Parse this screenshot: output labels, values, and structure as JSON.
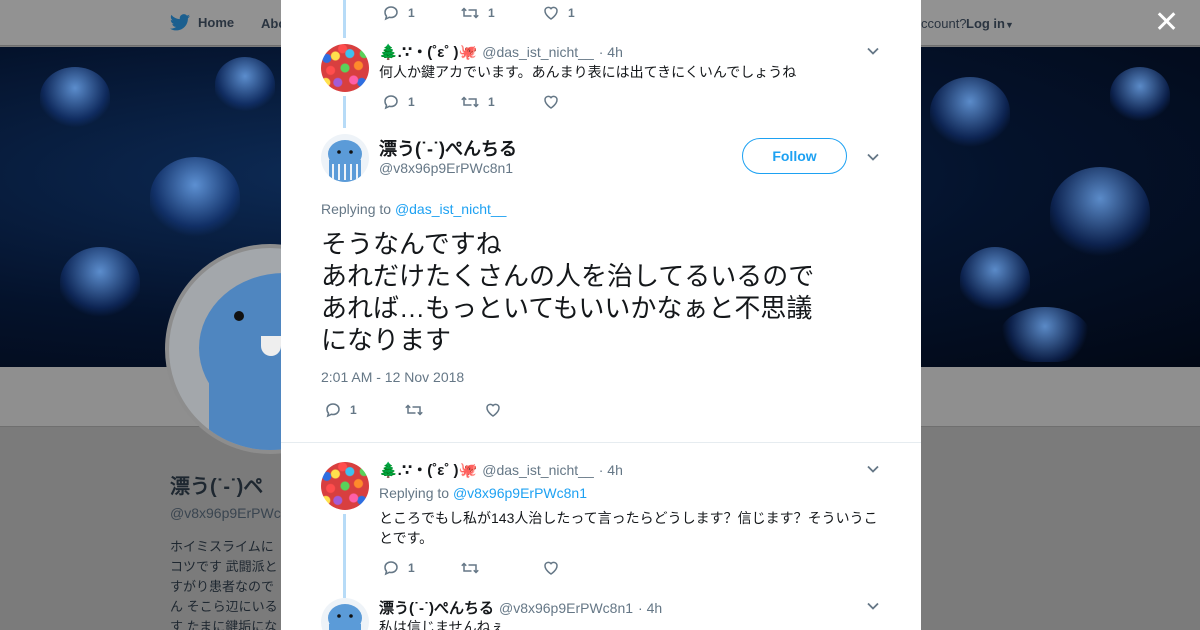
{
  "nav": {
    "home_label": "Home",
    "about_label": "Abo",
    "account_text": "ccount?",
    "login_label": "Log in"
  },
  "profile": {
    "name": "漂う(˙-˙)ペ",
    "handle": "@v8x96p9ErPWc",
    "bio": "ホイミスライムに\nコツです 武闘派と\nすがり患者なので\nん そこら辺にいる\nす たまに鍵垢にな"
  },
  "thread": [
    {
      "actions": {
        "reply": "1",
        "retweet": "1",
        "like": "1"
      }
    },
    {
      "name": "🌲.∵・(˚ε˚ )🐙",
      "handle": "@das_ist_nicht__",
      "time": "· 4h",
      "text": "何人か鍵アカでいます。あんまり表には出てきにくいんでしょうね",
      "actions": {
        "reply": "1",
        "retweet": "1",
        "like": ""
      }
    }
  ],
  "main_tweet": {
    "name": "漂う(˙-˙)ぺんちる",
    "handle": "@v8x96p9ErPWc8n1",
    "follow_label": "Follow",
    "replying_prefix": "Replying to",
    "replying_to": "@das_ist_nicht__",
    "text": "そうなんですね\nあれだけたくさんの人を治してるいるので\nあれば…もっといてもいいかなぁと不思議\nになります",
    "timestamp": "2:01 AM - 12 Nov 2018",
    "actions": {
      "reply": "1",
      "retweet": "",
      "like": ""
    }
  },
  "replies": [
    {
      "name": "🌲.∵・(˚ε˚ )🐙",
      "handle": "@das_ist_nicht__",
      "time": "· 4h",
      "replying_prefix": "Replying to",
      "replying_to": "@v8x96p9ErPWc8n1",
      "text": "ところでもし私が143人治したって言ったらどうします？信じます？そういうことです。",
      "actions": {
        "reply": "1",
        "retweet": "",
        "like": ""
      }
    },
    {
      "name": "漂う(˙-˙)ぺんちる",
      "handle": "@v8x96p9ErPWc8n1",
      "time": "· 4h",
      "text": "私は信じませんねぇ…"
    }
  ],
  "icons": [
    "twitter-bird-icon",
    "close-icon",
    "reply-icon",
    "retweet-icon",
    "like-icon",
    "chevron-down-icon",
    "caret-down-icon"
  ],
  "colors": {
    "accent": "#1da1f2",
    "thread_line": "#b7dbf7",
    "muted": "#657786"
  }
}
